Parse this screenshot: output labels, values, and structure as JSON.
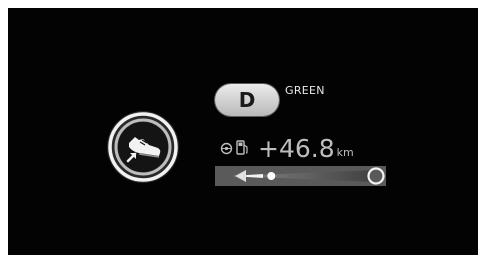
{
  "display": {
    "gear": "D",
    "drive_mode": "GREEN",
    "range_gain": "+46.8",
    "range_unit": "km",
    "eco_gauge_level": 0.27
  },
  "icons": {
    "mode_icon": "eco-shoe-icon",
    "target_icon": "target-circle-icon",
    "fuel_icon": "fuel-pump-icon"
  },
  "colors": {
    "background": "#030303",
    "text": "#bdbdbd",
    "badge": "#d9d9d9"
  }
}
